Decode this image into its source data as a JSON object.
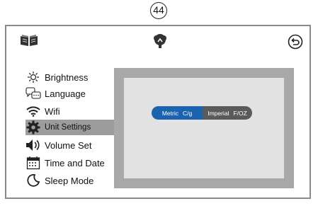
{
  "page_number": "44",
  "header": {
    "left_icon": "book-icon",
    "center_icon": "logo-icon",
    "right_icon": "back-icon"
  },
  "menu": {
    "items": [
      {
        "label": "Brightness",
        "icon": "brightness-icon"
      },
      {
        "label": "Language",
        "icon": "language-icon"
      },
      {
        "label": "Wifi",
        "icon": "wifi-icon"
      },
      {
        "label": "Unit Settings",
        "icon": "gear-icon",
        "selected": true
      },
      {
        "label": "Volume Set",
        "icon": "speaker-icon"
      },
      {
        "label": "Time and Date",
        "icon": "calendar-icon"
      },
      {
        "label": "Sleep Mode",
        "icon": "sleep-icon"
      }
    ]
  },
  "unit_toggle": {
    "metric_label": "Metric",
    "metric_units": "C/g",
    "imperial_label": "Imperial",
    "imperial_units": "F/OZ",
    "selected": "metric",
    "colors": {
      "selected": "#1b63ae",
      "unselected": "#5a5a5a"
    }
  }
}
